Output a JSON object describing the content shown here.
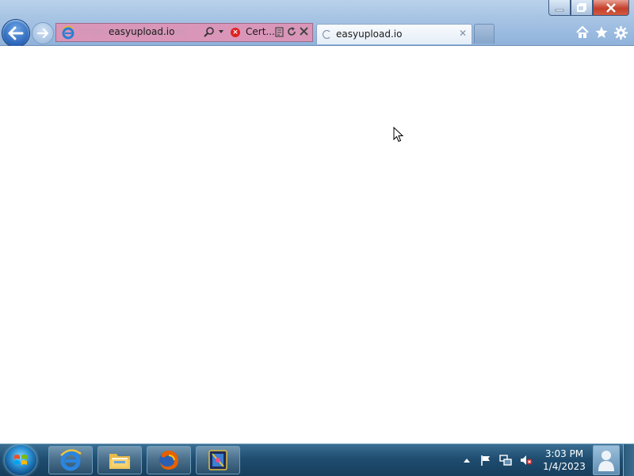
{
  "browser": {
    "address_bar": {
      "url_faded": "https://easyupload.io/",
      "host": "easyupload.io",
      "cert_error_label": "Cert..."
    },
    "tabs": [
      {
        "title": "easyupload.io",
        "state": "loading"
      }
    ],
    "icons": {
      "back": "back-arrow-icon",
      "forward": "forward-arrow-icon",
      "home": "home-icon",
      "favorites": "star-icon",
      "tools": "gear-icon"
    },
    "colors": {
      "address_bar_error": "#d996b9",
      "chrome": "#a7c4e4"
    }
  },
  "taskbar": {
    "pinned": [
      "internet-explorer",
      "windows-explorer",
      "firefox",
      "app"
    ],
    "clock": {
      "time": "3:03 PM",
      "date": "1/4/2023"
    },
    "tray_icons": [
      "show-hidden-icons",
      "action-center-flag",
      "network",
      "volume-muted"
    ]
  }
}
